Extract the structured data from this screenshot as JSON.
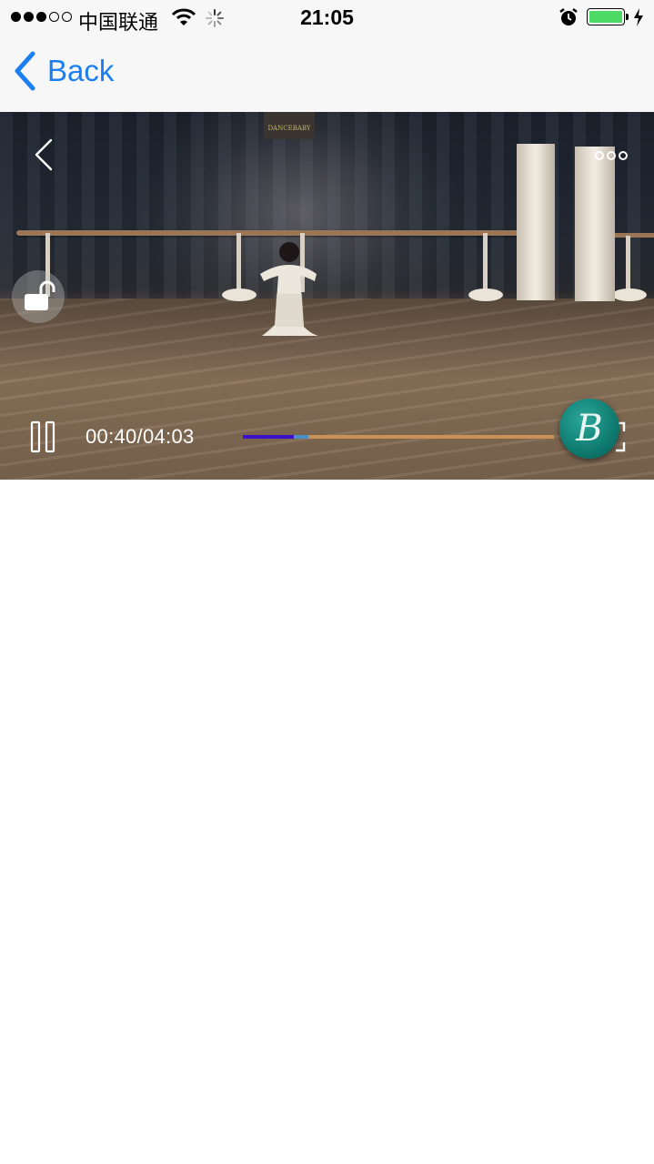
{
  "status_bar": {
    "carrier": "中国联通",
    "time": "21:05",
    "signal_bars_filled": 3,
    "signal_bars_total": 5,
    "battery_level": 1.0,
    "battery_color": "#4cd964",
    "icons": [
      "signal-dots-icon",
      "wifi-icon",
      "activity-spinner-icon",
      "alarm-clock-icon",
      "battery-icon",
      "charging-bolt-icon"
    ]
  },
  "nav_bar": {
    "back_label": "Back",
    "accent_color": "#1b7ff1"
  },
  "video_player": {
    "time_display": "00:40/04:03",
    "elapsed_seconds": 40,
    "duration_seconds": 243,
    "buffered_fraction": 0.21,
    "played_fraction": 0.165,
    "sign_text": "DANCEBABY",
    "badge_letter": "B",
    "icons": [
      "chevron-left-icon",
      "more-dots-icon",
      "unlock-icon",
      "pause-icon",
      "fullscreen-icon"
    ]
  }
}
